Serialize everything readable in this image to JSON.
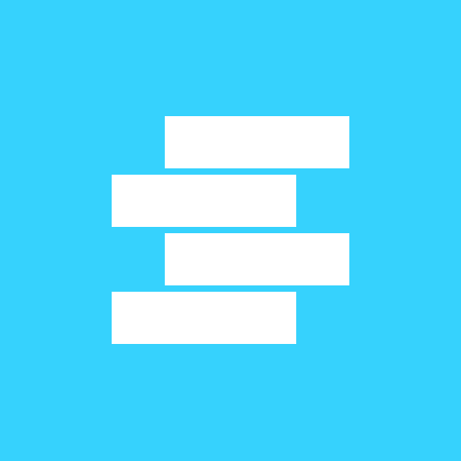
{
  "icon": {
    "name": "stacked-bars-logo",
    "background_color": "#36d2fd",
    "bar_color": "#ffffff",
    "bars": [
      "top",
      "second",
      "third",
      "bottom"
    ]
  }
}
